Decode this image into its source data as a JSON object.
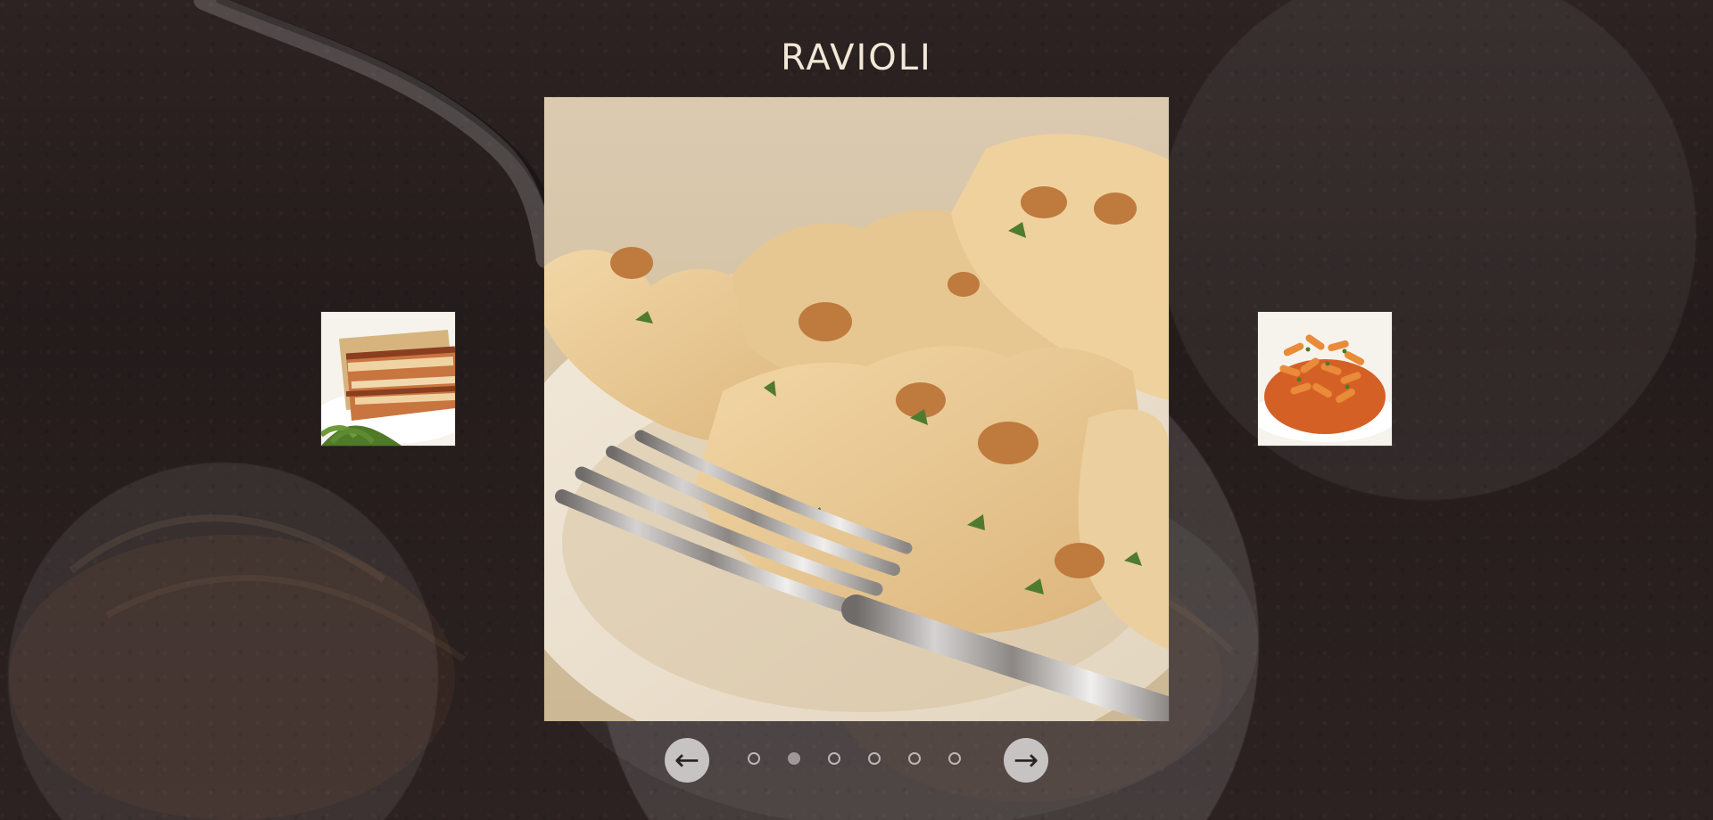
{
  "page": {
    "title": "RAVIOLI"
  },
  "slider": {
    "active_index": 1,
    "dots_count": 6,
    "prev_label": "←",
    "next_label": "→",
    "main_dish_icon": "ravioli-image",
    "left_dish_icon": "lasagna-image",
    "right_dish_icon": "penne-image"
  }
}
